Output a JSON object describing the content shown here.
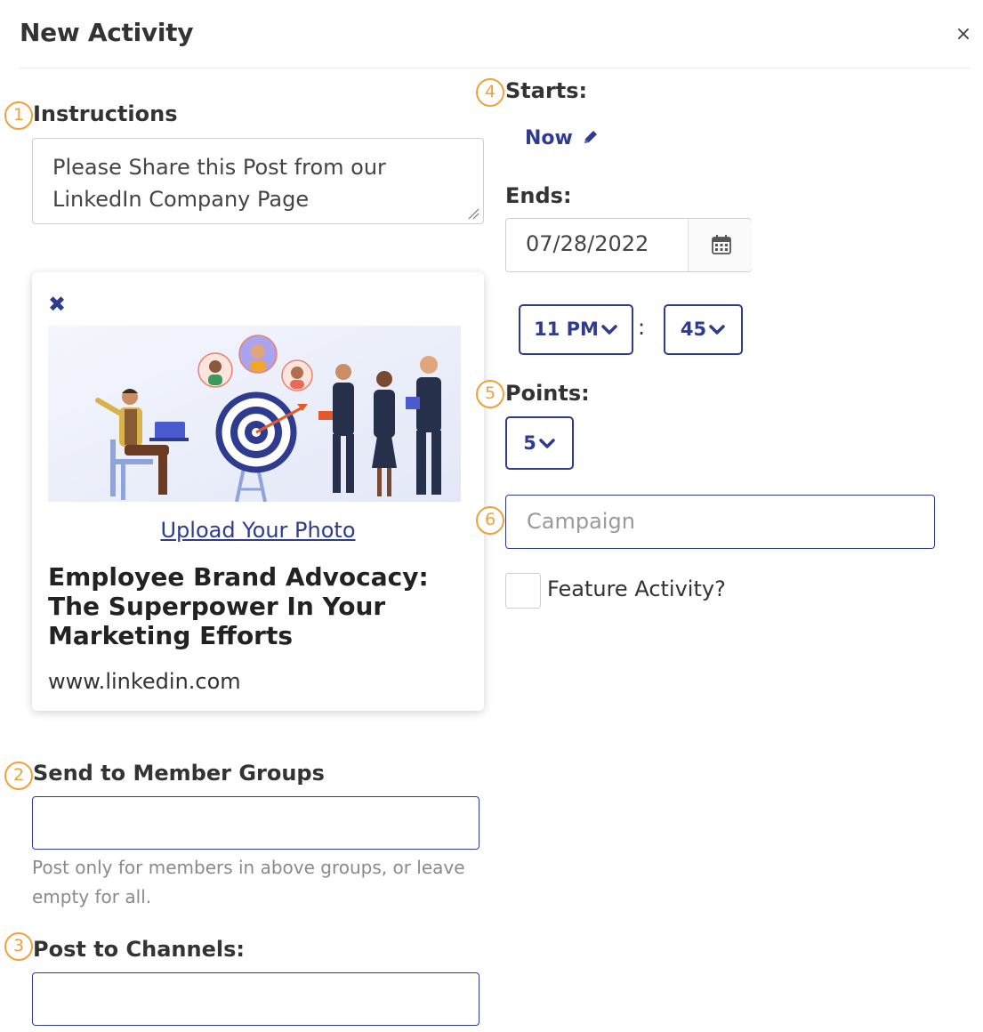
{
  "modal": {
    "title": "New Activity",
    "close_label": "×"
  },
  "markers": [
    "1",
    "2",
    "3",
    "4",
    "5",
    "6"
  ],
  "instructions": {
    "label": "Instructions",
    "value_line1": "Please Share this Post from our",
    "value_line2": "LinkedIn Company Page"
  },
  "preview_card": {
    "remove_label": "✖",
    "upload_label": "Upload Your Photo",
    "headline": "Employee Brand Advocacy: The Superpower In Your Marketing Efforts",
    "url": "www.linkedin.com"
  },
  "member_groups": {
    "label": "Send to Member Groups",
    "value": "",
    "helper_line1": "Post only for members in above groups, or leave",
    "helper_line2": "empty for all."
  },
  "channels": {
    "label": "Post to Channels:",
    "value": ""
  },
  "starts": {
    "label": "Starts:",
    "value": "Now"
  },
  "ends": {
    "label": "Ends:",
    "date": "07/28/2022",
    "hour": "11 PM",
    "separator": ":",
    "minute": "45"
  },
  "points": {
    "label": "Points:",
    "value": "5"
  },
  "campaign": {
    "placeholder": "Campaign"
  },
  "feature": {
    "label": "Feature Activity?",
    "checked": false
  },
  "colors": {
    "accent": "#2f3b8f",
    "marker": "#f0a13a"
  }
}
